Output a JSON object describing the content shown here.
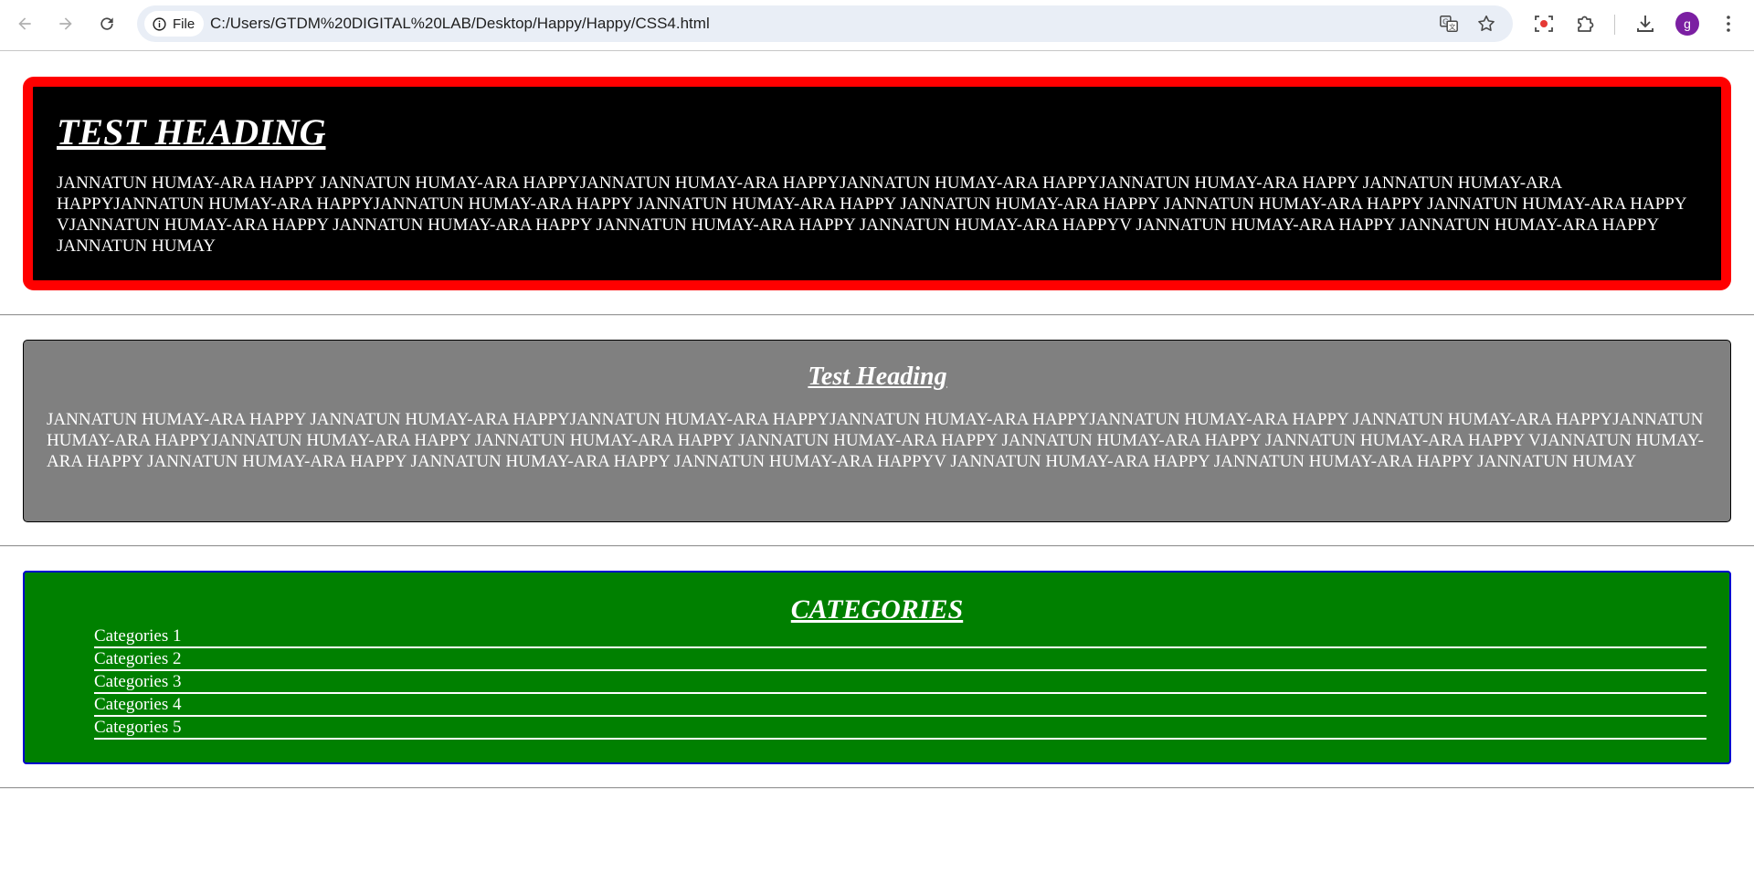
{
  "browser": {
    "site_chip_label": "File",
    "url": "C:/Users/GTDM%20DIGITAL%20LAB/Desktop/Happy/Happy/CSS4.html",
    "profile_initial": "g"
  },
  "section1": {
    "heading": "TEST HEADING",
    "text": "JANNATUN HUMAY-ARA HAPPY JANNATUN HUMAY-ARA HAPPYJANNATUN HUMAY-ARA HAPPYJANNATUN HUMAY-ARA HAPPYJANNATUN HUMAY-ARA HAPPY JANNATUN HUMAY-ARA HAPPYJANNATUN HUMAY-ARA HAPPYJANNATUN HUMAY-ARA HAPPY JANNATUN HUMAY-ARA HAPPY JANNATUN HUMAY-ARA HAPPY JANNATUN HUMAY-ARA HAPPY JANNATUN HUMAY-ARA HAPPY VJANNATUN HUMAY-ARA HAPPY JANNATUN HUMAY-ARA HAPPY JANNATUN HUMAY-ARA HAPPY JANNATUN HUMAY-ARA HAPPYV JANNATUN HUMAY-ARA HAPPY JANNATUN HUMAY-ARA HAPPY JANNATUN HUMAY",
    "colors": {
      "background": "#000000",
      "border": "#ff0000",
      "text": "#ffffff"
    }
  },
  "section2": {
    "heading": "Test Heading",
    "text": "JANNATUN HUMAY-ARA HAPPY JANNATUN HUMAY-ARA HAPPYJANNATUN HUMAY-ARA HAPPYJANNATUN HUMAY-ARA HAPPYJANNATUN HUMAY-ARA HAPPY JANNATUN HUMAY-ARA HAPPYJANNATUN HUMAY-ARA HAPPYJANNATUN HUMAY-ARA HAPPY JANNATUN HUMAY-ARA HAPPY JANNATUN HUMAY-ARA HAPPY JANNATUN HUMAY-ARA HAPPY JANNATUN HUMAY-ARA HAPPY VJANNATUN HUMAY-ARA HAPPY JANNATUN HUMAY-ARA HAPPY JANNATUN HUMAY-ARA HAPPY JANNATUN HUMAY-ARA HAPPYV JANNATUN HUMAY-ARA HAPPY JANNATUN HUMAY-ARA HAPPY JANNATUN HUMAY",
    "colors": {
      "background": "#808080",
      "border": "#000000",
      "text": "#ffffff"
    }
  },
  "section3": {
    "heading": "CATEGORIES",
    "items": [
      "Categories 1",
      "Categories 2",
      "Categories 3",
      "Categories 4",
      "Categories 5"
    ],
    "colors": {
      "background": "#008000",
      "border": "#0000cd",
      "text": "#ffffff"
    }
  },
  "icons": {
    "back": "arrow-left-icon",
    "forward": "arrow-right-icon",
    "reload": "reload-icon",
    "info": "info-icon",
    "translate": "translate-icon",
    "bookmark": "star-icon",
    "screen_capture": "screen-capture-icon",
    "extensions": "puzzle-icon",
    "downloads": "download-icon",
    "menu": "kebab-menu-icon"
  }
}
